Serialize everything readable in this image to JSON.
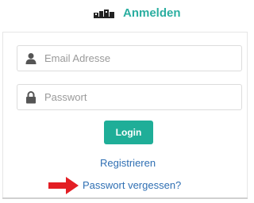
{
  "header": {
    "title": "Anmelden"
  },
  "form": {
    "email_placeholder": "Email Adresse",
    "password_placeholder": "Passwort",
    "login_label": "Login"
  },
  "links": {
    "register": "Registrieren",
    "forgot_password": "Passwort vergessen?"
  },
  "icons": {
    "logo": "logo-image",
    "email": "user-icon",
    "password": "lock-icon",
    "annotation": "red-arrow-icon"
  },
  "colors": {
    "accent": "#2aaea0",
    "button": "#1fae98",
    "link": "#2f6fb3",
    "arrow": "#e31e24"
  }
}
